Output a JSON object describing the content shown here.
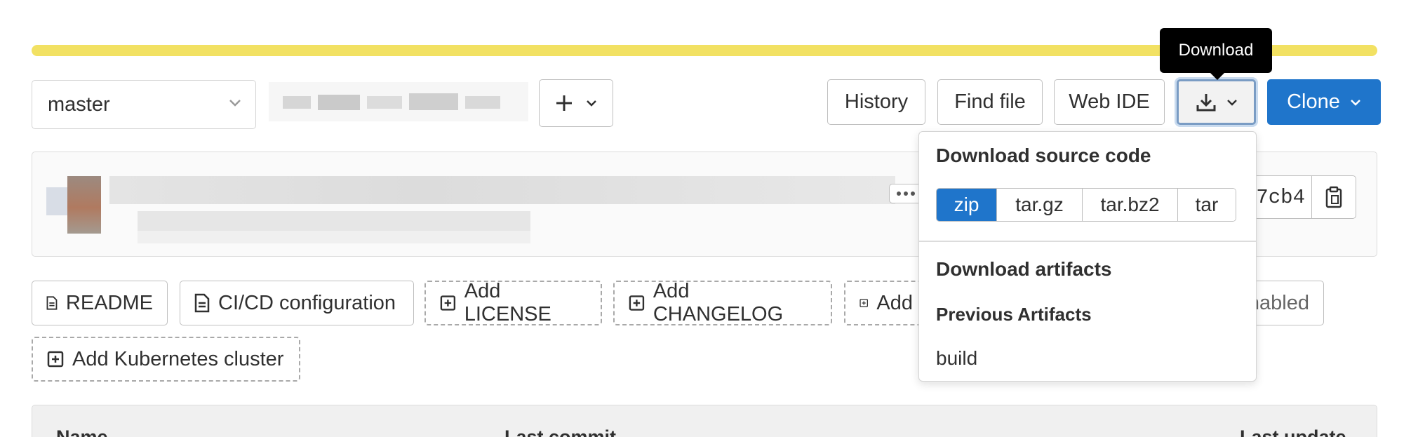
{
  "tooltip": {
    "download": "Download"
  },
  "branch": {
    "selected": "master"
  },
  "toolbar": {
    "history_label": "History",
    "find_file_label": "Find file",
    "web_ide_label": "Web IDE",
    "clone_label": "Clone"
  },
  "commit": {
    "sha_short": "7cb4"
  },
  "shortcuts": {
    "readme": "README",
    "cicd": "CI/CD configuration",
    "add_license": "Add LICENSE",
    "add_changelog": "Add CHANGELOG",
    "add_cut": "Add",
    "enabled_cut": "nabled",
    "add_k8s": "Add Kubernetes cluster"
  },
  "download_menu": {
    "source_title": "Download source code",
    "formats": [
      "zip",
      "tar.gz",
      "tar.bz2",
      "tar"
    ],
    "active_format": "zip",
    "artifacts_title": "Download artifacts",
    "previous_title": "Previous Artifacts",
    "artifact_item": "build"
  },
  "table": {
    "col_name": "Name",
    "col_last_commit": "Last commit",
    "col_last_update": "Last update"
  },
  "colors": {
    "accent": "#1f75cb",
    "progress_bar": "#f2e163",
    "tooltip_bg": "#000000"
  }
}
